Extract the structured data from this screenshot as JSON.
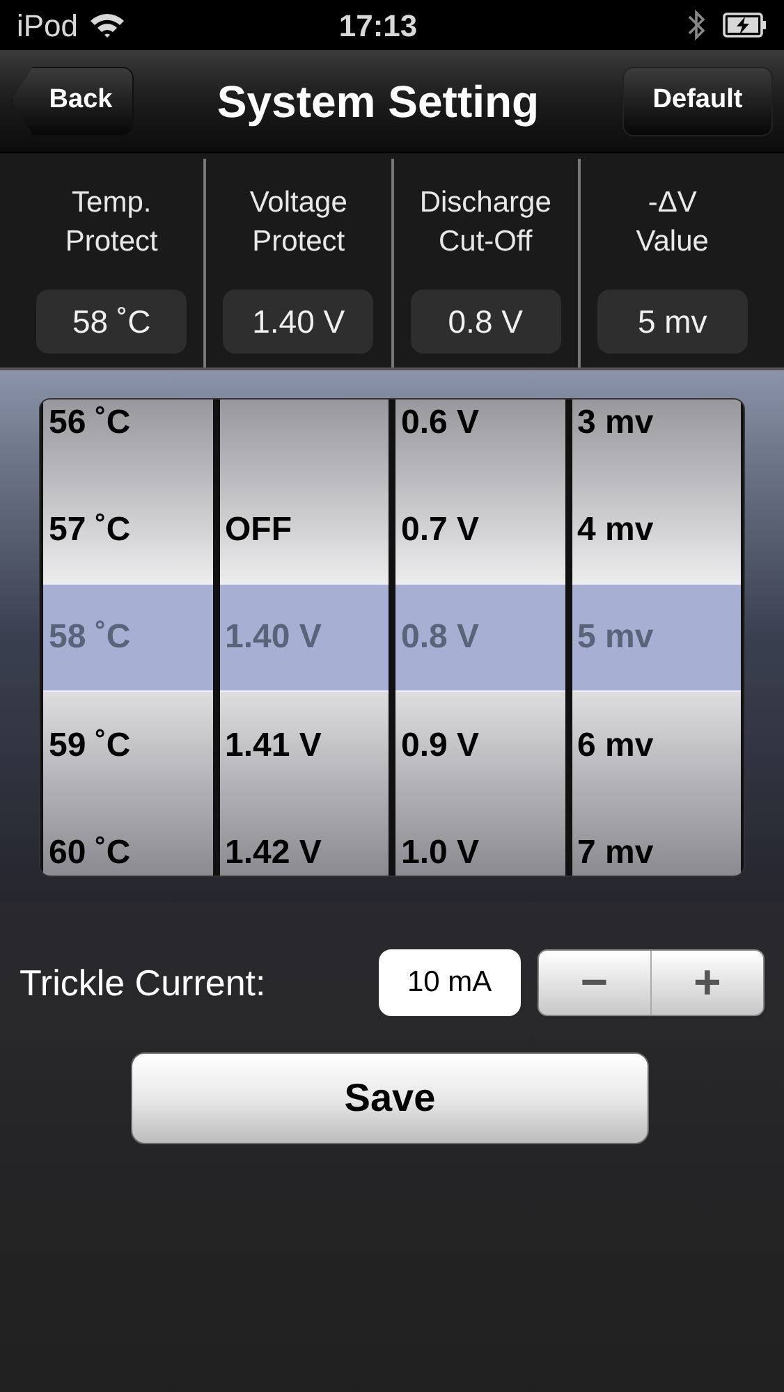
{
  "status_bar": {
    "carrier": "iPod",
    "time": "17:13"
  },
  "nav": {
    "back": "Back",
    "title": "System Setting",
    "action": "Default"
  },
  "settings": [
    {
      "label": "Temp.\nProtect",
      "value": "58 ˚C"
    },
    {
      "label": "Voltage\nProtect",
      "value": "1.40 V"
    },
    {
      "label": "Discharge\nCut-Off",
      "value": "0.8 V"
    },
    {
      "label": "-ΔV\nValue",
      "value": "5 mv"
    }
  ],
  "picker": {
    "columns": [
      {
        "items": [
          {
            "text": "56 ˚C",
            "selected": false
          },
          {
            "text": "57 ˚C",
            "selected": false
          },
          {
            "text": "58 ˚C",
            "selected": true
          },
          {
            "text": "59 ˚C",
            "selected": false
          },
          {
            "text": "60 ˚C",
            "selected": false
          }
        ]
      },
      {
        "items": [
          {
            "text": "OFF",
            "selected": false
          },
          {
            "text": "1.40 V",
            "selected": true
          },
          {
            "text": "1.41 V",
            "selected": false
          },
          {
            "text": "1.42 V",
            "selected": false
          }
        ]
      },
      {
        "items": [
          {
            "text": "0.6 V",
            "selected": false
          },
          {
            "text": "0.7 V",
            "selected": false
          },
          {
            "text": "0.8 V",
            "selected": true
          },
          {
            "text": "0.9 V",
            "selected": false
          },
          {
            "text": "1.0 V",
            "selected": false
          }
        ]
      },
      {
        "items": [
          {
            "text": "3 mv",
            "selected": false
          },
          {
            "text": "4 mv",
            "selected": false
          },
          {
            "text": "5 mv",
            "selected": true
          },
          {
            "text": "6 mv",
            "selected": false
          },
          {
            "text": "7 mv",
            "selected": false
          }
        ]
      }
    ]
  },
  "trickle": {
    "label": "Trickle Current:",
    "value": "10 mA",
    "minus": "−",
    "plus": "+"
  },
  "save": "Save"
}
